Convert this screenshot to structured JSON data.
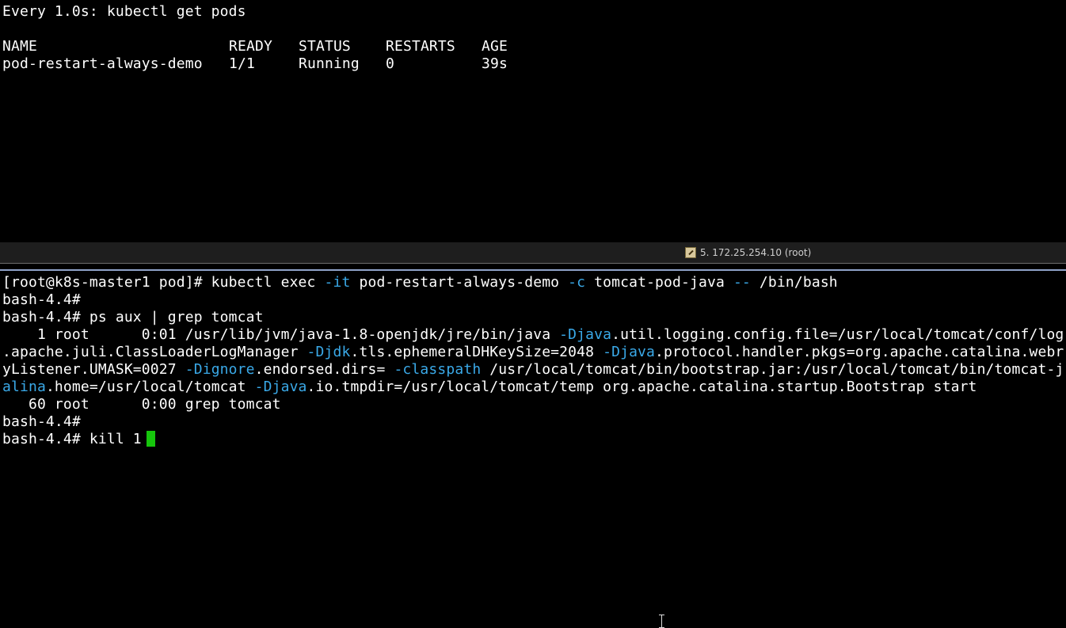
{
  "top_pane": {
    "watch_header": "Every 1.0s: kubectl get pods",
    "table": {
      "headers": [
        "NAME",
        "READY",
        "STATUS",
        "RESTARTS",
        "AGE"
      ],
      "rows": [
        [
          "pod-restart-always-demo",
          "1/1",
          "Running",
          "0",
          "39s"
        ]
      ]
    }
  },
  "session_tab": {
    "label": "5. 172.25.254.10 (root)",
    "icon": "terminal-session-icon"
  },
  "bottom_pane": {
    "lines": {
      "l1_prompt": "[root@k8s-master1 pod]# kubectl exec ",
      "l1_f1": "-it",
      "l1_t1": " pod-restart-always-demo ",
      "l1_f2": "-c",
      "l1_t2": " tomcat-pod-java ",
      "l1_f3": "--",
      "l1_t3": " /bin/bash",
      "l2": "bash-4.4#",
      "l3": "bash-4.4# ps aux | grep tomcat",
      "l4_t1": "    1 root      0:01 /usr/lib/jvm/java-1.8-openjdk/jre/bin/java ",
      "l4_f1": "-Djava",
      "l4_t2": ".util.logging.config.file=/usr/local/tomcat/conf/log",
      "l5_t1": ".apache.juli.ClassLoaderLogManager ",
      "l5_f1": "-Djdk",
      "l5_t2": ".tls.ephemeralDHKeySize=2048 ",
      "l5_f2": "-Djava",
      "l5_t3": ".protocol.handler.pkgs=org.apache.catalina.webr",
      "l6_t1": "yListener.UMASK=0027 ",
      "l6_f1": "-Dignore",
      "l6_t2": ".endorsed.dirs= ",
      "l6_f2": "-classpath",
      "l6_t3": " /usr/local/tomcat/bin/bootstrap.jar:/usr/local/tomcat/bin/tomcat-j",
      "l7_f1": "alina",
      "l7_t1": ".home=/usr/local/tomcat ",
      "l7_f2": "-Djava",
      "l7_t2": ".io.tmpdir=/usr/local/tomcat/temp org.apache.catalina.startup.Bootstrap start",
      "l8": "   60 root      0:00 grep tomcat",
      "l9": "bash-4.4#",
      "l10": "bash-4.4# kill 1"
    }
  },
  "colors": {
    "background": "#000000",
    "text": "#ffffff",
    "flag_highlight": "#3aa9e8",
    "cursor": "#16c60c",
    "divider_accent": "#8fa3c9"
  }
}
